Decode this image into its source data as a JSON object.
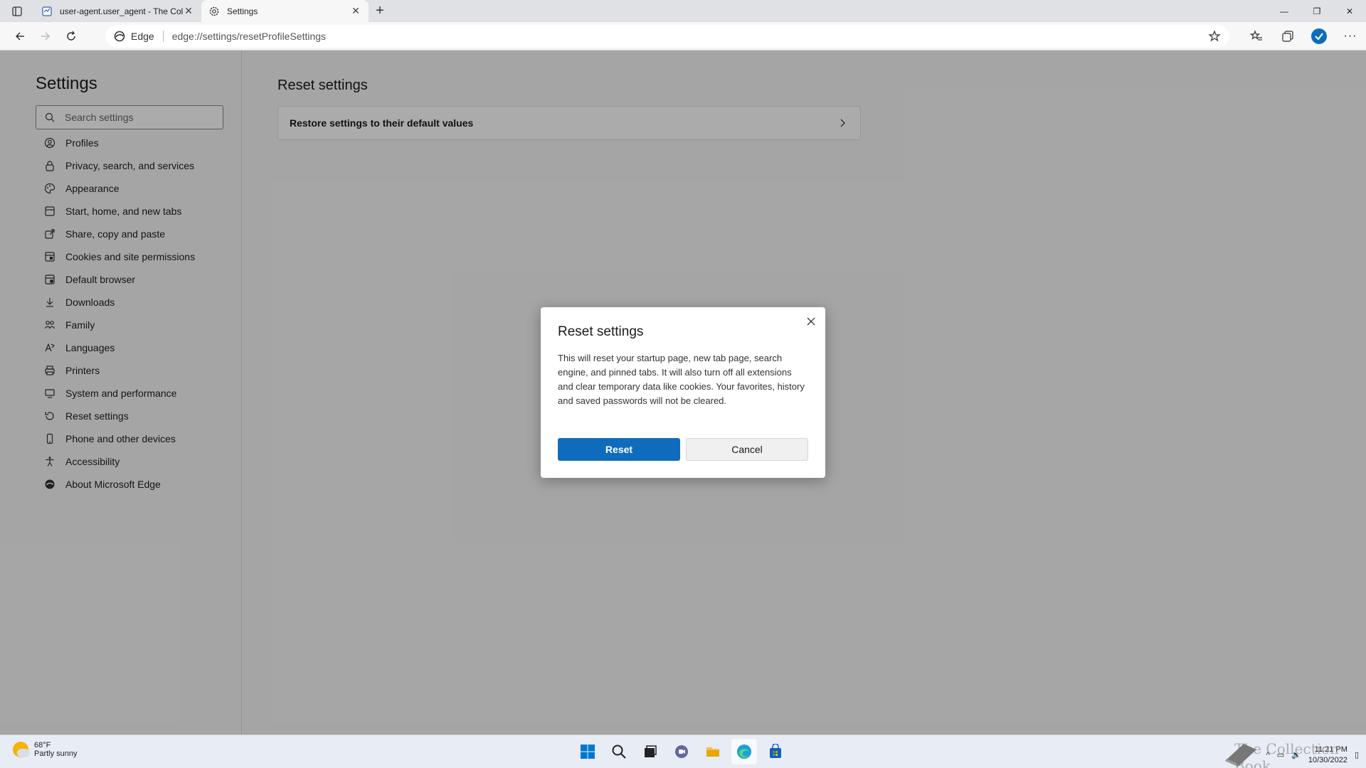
{
  "tabs": [
    {
      "title": "user-agent.user_agent - The Coll",
      "active": false
    },
    {
      "title": "Settings",
      "active": true
    }
  ],
  "address": {
    "site_label": "Edge",
    "url": "edge://settings/resetProfileSettings"
  },
  "sidebar": {
    "title": "Settings",
    "search_placeholder": "Search settings",
    "items": [
      {
        "label": "Profiles",
        "icon": "profile-icon"
      },
      {
        "label": "Privacy, search, and services",
        "icon": "lock-icon"
      },
      {
        "label": "Appearance",
        "icon": "palette-icon"
      },
      {
        "label": "Start, home, and new tabs",
        "icon": "home-icon"
      },
      {
        "label": "Share, copy and paste",
        "icon": "share-icon"
      },
      {
        "label": "Cookies and site permissions",
        "icon": "cookie-icon"
      },
      {
        "label": "Default browser",
        "icon": "browser-icon"
      },
      {
        "label": "Downloads",
        "icon": "download-icon"
      },
      {
        "label": "Family",
        "icon": "family-icon"
      },
      {
        "label": "Languages",
        "icon": "language-icon"
      },
      {
        "label": "Printers",
        "icon": "printer-icon"
      },
      {
        "label": "System and performance",
        "icon": "system-icon"
      },
      {
        "label": "Reset settings",
        "icon": "reset-icon"
      },
      {
        "label": "Phone and other devices",
        "icon": "phone-icon"
      },
      {
        "label": "Accessibility",
        "icon": "accessibility-icon"
      },
      {
        "label": "About Microsoft Edge",
        "icon": "edge-icon"
      }
    ]
  },
  "main": {
    "title": "Reset settings",
    "card_label": "Restore settings to their default values"
  },
  "dialog": {
    "title": "Reset settings",
    "body": "This will reset your startup page, new tab page, search engine, and pinned tabs. It will also turn off all extensions and clear temporary data like cookies. Your favorites, history and saved passwords will not be cleared.",
    "primary": "Reset",
    "secondary": "Cancel"
  },
  "taskbar": {
    "temp": "68°F",
    "condition": "Partly sunny",
    "time": "11:21 PM",
    "date": "10/30/2022"
  },
  "watermark": "The Collection Book",
  "colors": {
    "accent": "#0f6cbd",
    "overlay": "rgba(0,0,0,0.33)"
  }
}
